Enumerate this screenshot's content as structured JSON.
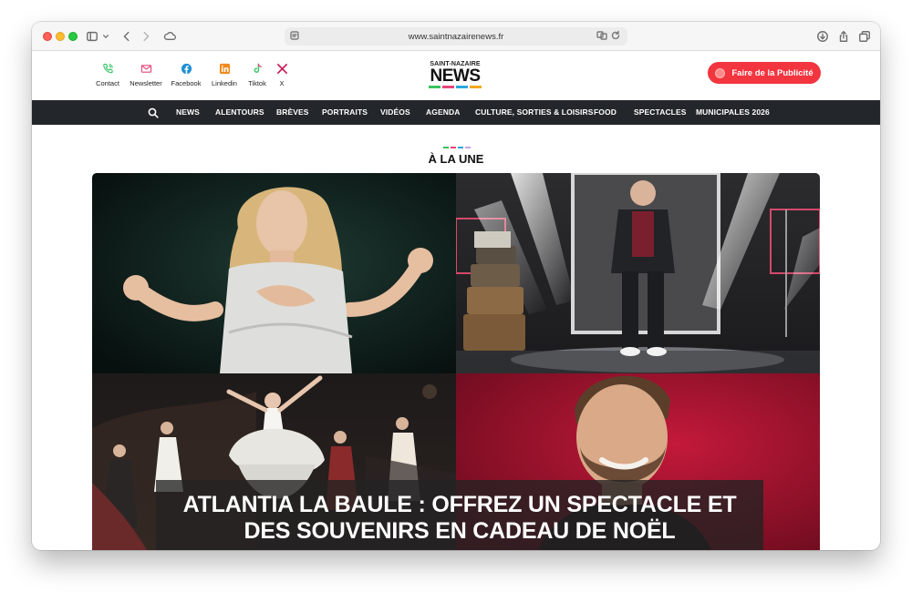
{
  "browser": {
    "url": "www.saintnazairenews.fr"
  },
  "header": {
    "social": [
      {
        "label": "Contact",
        "icon": "phone-icon",
        "color": "#3cc46a"
      },
      {
        "label": "Newsletter",
        "icon": "mail-icon",
        "color": "#e8457a"
      },
      {
        "label": "Facebook",
        "icon": "facebook-icon",
        "color": "#1f8fd4"
      },
      {
        "label": "Linkedin",
        "icon": "linkedin-icon",
        "color": "#f08a1c"
      },
      {
        "label": "Tiktok",
        "icon": "tiktok-icon",
        "color": "#3cc46a"
      },
      {
        "label": "X",
        "icon": "x-icon",
        "color": "#c8205a"
      }
    ],
    "logo": {
      "top": "SAINT-NAZAIRE",
      "main": "NEWS",
      "bar_colors": [
        "#37c25e",
        "#e8457a",
        "#2aa7df",
        "#f5a623"
      ]
    },
    "cta_label": "Faire de la Publicité",
    "cta_color": "#f2353f"
  },
  "nav": {
    "items": [
      "NEWS",
      "ALENTOURS",
      "BRÈVES",
      "PORTRAITS",
      "VIDÉOS",
      "AGENDA",
      "CULTURE, SORTIES & LOISIRS",
      "FOOD",
      "SPECTACLES",
      "MUNICIPALES 2026"
    ]
  },
  "section": {
    "title": "À LA UNE",
    "bar_colors": [
      "#37c25e",
      "#e8457a",
      "#2aa7df",
      "#c8a0e8"
    ]
  },
  "hero": {
    "headline": "ATLANTIA LA BAULE : OFFREZ UN SPECTACLE ET DES SOUVENIRS EN CADEAU DE NOËL"
  }
}
